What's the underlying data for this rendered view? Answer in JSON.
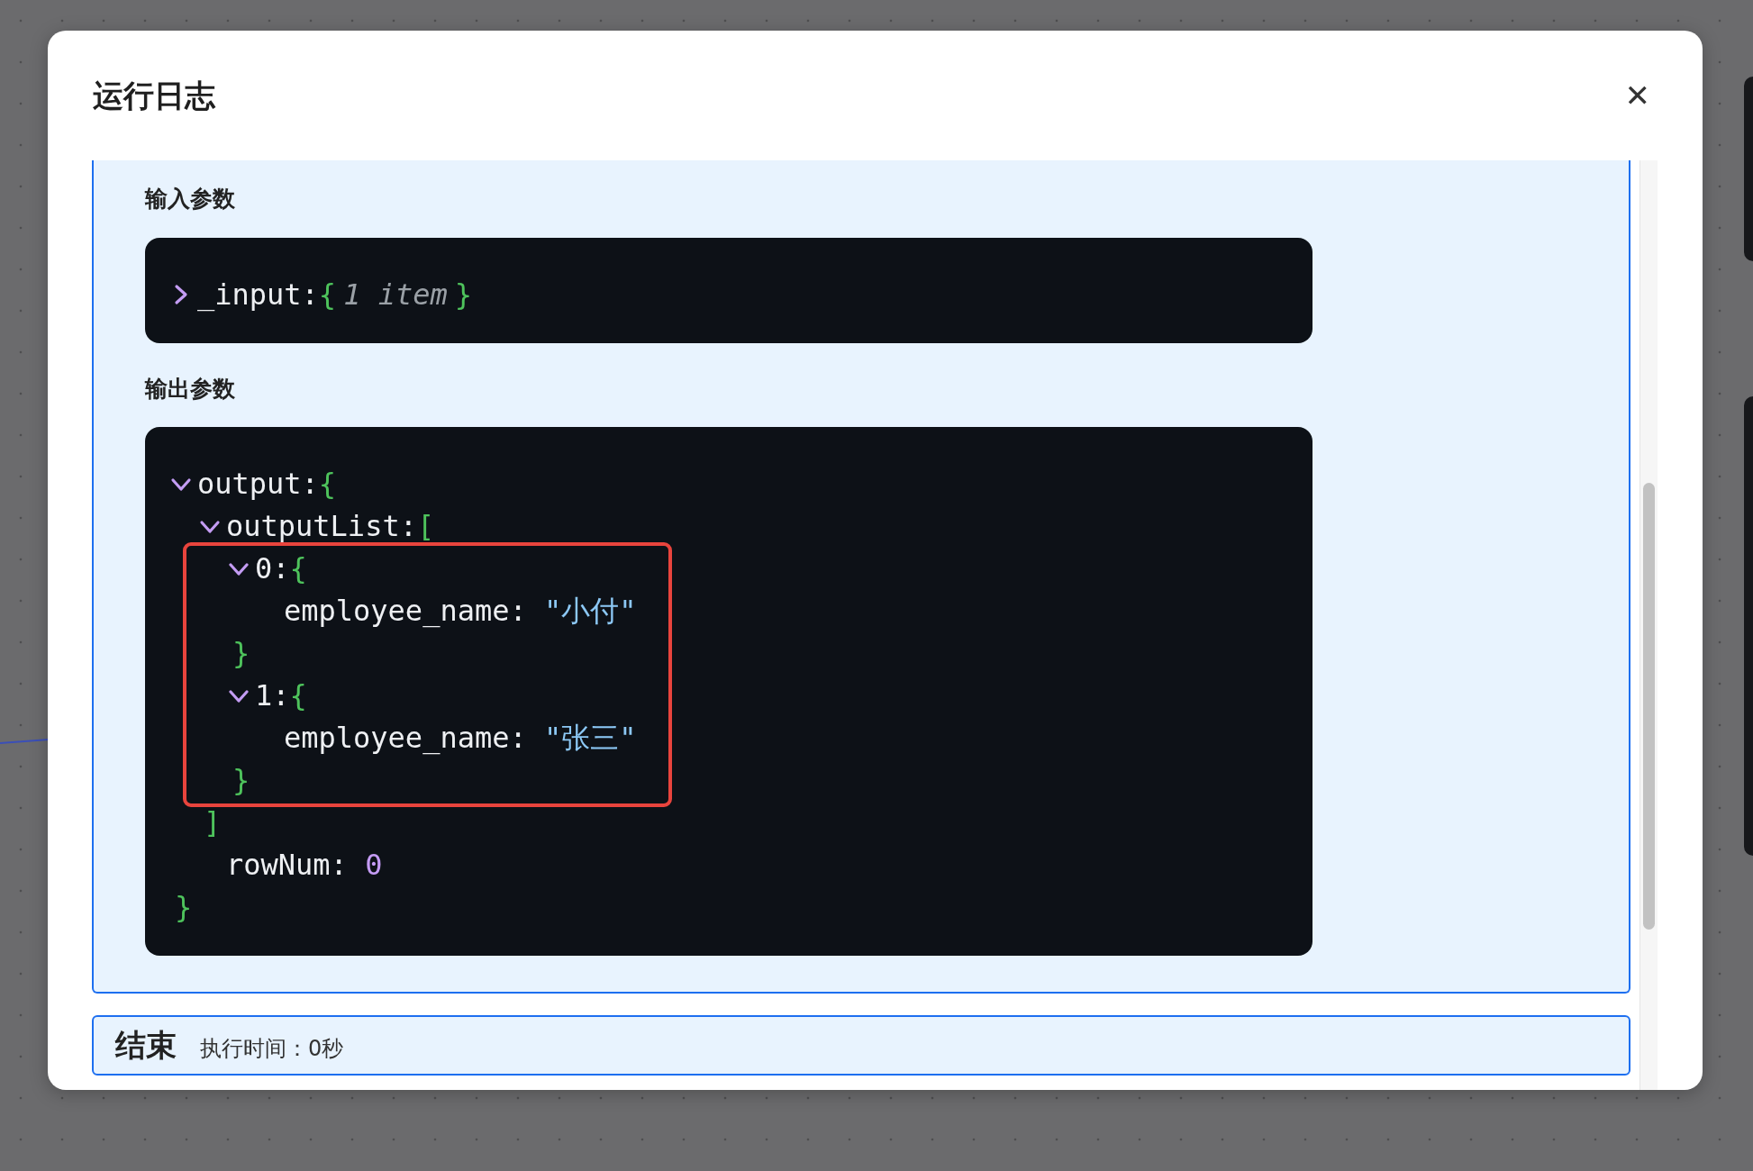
{
  "dialog": {
    "title": "运行日志",
    "close_label": "✕"
  },
  "panel": {
    "sections": [
      {
        "label": "输入参数",
        "tree": [
          {
            "key": "_input:",
            "open": "{",
            "close": "}",
            "expanded": false,
            "summary": "1 item"
          }
        ]
      },
      {
        "label": "输出参数",
        "tree": [
          {
            "key": "output:",
            "open": "{",
            "close": "}",
            "expanded": true,
            "children": [
              {
                "key": "outputList:",
                "open": "[",
                "close": "]",
                "expanded": true,
                "children": [
                  {
                    "key": "0:",
                    "open": "{",
                    "close": "}",
                    "expanded": true,
                    "highlighted": true,
                    "children": [
                      {
                        "key": "employee_name:",
                        "value": "\"小付\"",
                        "kind": "string"
                      }
                    ]
                  },
                  {
                    "key": "1:",
                    "open": "{",
                    "close": "}",
                    "expanded": true,
                    "highlighted": true,
                    "children": [
                      {
                        "key": "employee_name:",
                        "value": "\"张三\"",
                        "kind": "string"
                      }
                    ]
                  }
                ]
              },
              {
                "key": "rowNum:",
                "value": "0",
                "kind": "number"
              }
            ]
          }
        ]
      }
    ]
  },
  "next_panel": {
    "title": "结束",
    "meta": "执行时间：0秒"
  }
}
